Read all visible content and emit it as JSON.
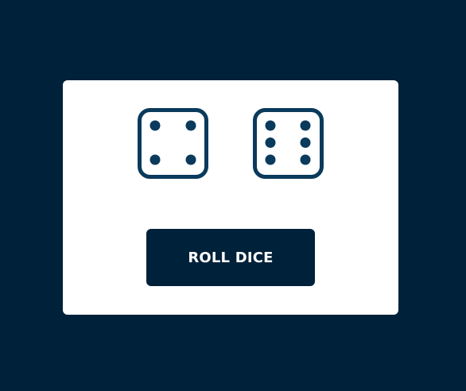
{
  "colors": {
    "background": "#00213a",
    "card": "#ffffff",
    "die_stroke": "#0a3a5c",
    "pip": "#0a3a5c",
    "button_bg": "#00213a",
    "button_text": "#ffffff"
  },
  "dice": [
    {
      "value": 4,
      "icon": "dice-four-icon"
    },
    {
      "value": 6,
      "icon": "dice-six-icon"
    }
  ],
  "roll_button": {
    "label": "ROLL DICE"
  }
}
